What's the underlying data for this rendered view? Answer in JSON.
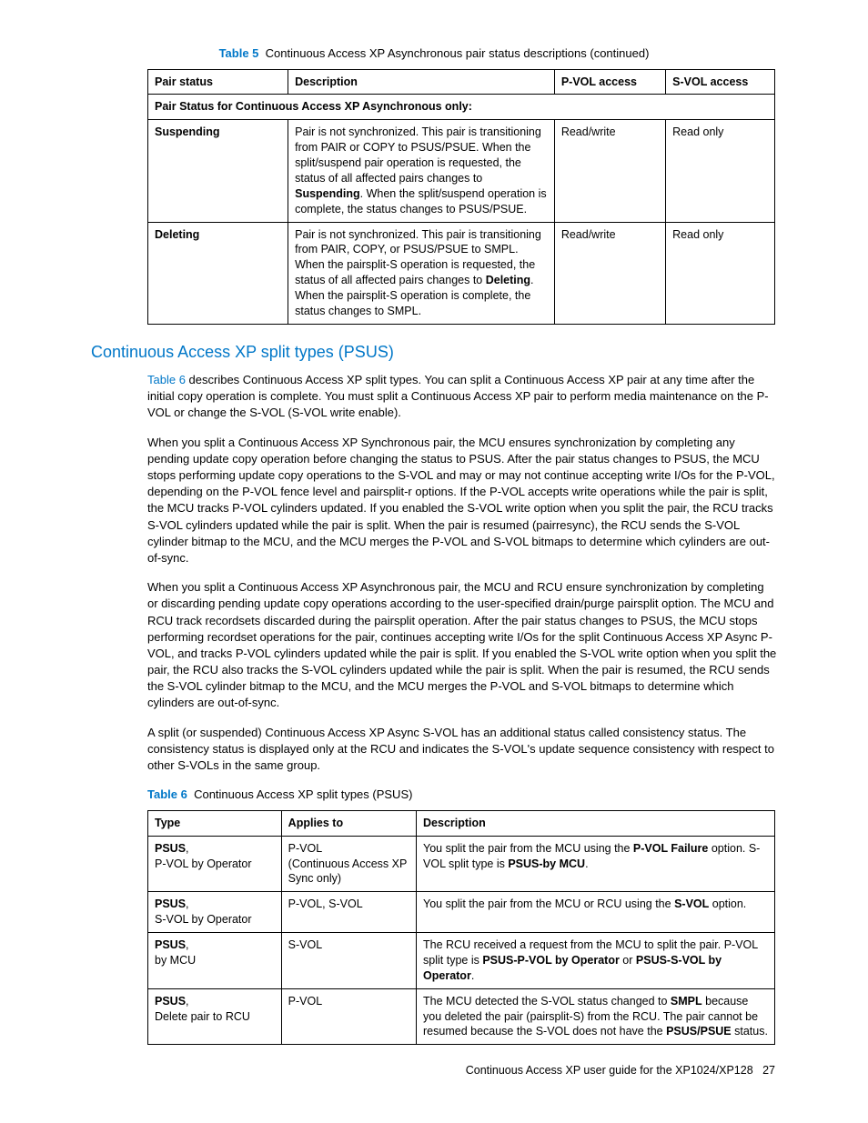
{
  "table5": {
    "caption_label": "Table 5",
    "caption_text": "Continuous Access XP Asynchronous pair status descriptions (continued)",
    "headers": [
      "Pair status",
      "Description",
      "P-VOL access",
      "S-VOL access"
    ],
    "section_row": "Pair Status for Continuous Access XP Asynchronous only:",
    "rows": [
      {
        "status": "Suspending",
        "desc_pre": "Pair is not synchronized. This pair is transitioning from PAIR or COPY to PSUS/PSUE. When the split/suspend pair operation is requested, the status of all affected pairs changes to ",
        "desc_bold": "Suspending",
        "desc_post": ". When the split/suspend operation is complete, the status changes to PSUS/PSUE.",
        "pvol": "Read/write",
        "svol": "Read only"
      },
      {
        "status": "Deleting",
        "desc_pre": "Pair is not synchronized. This pair is transitioning from PAIR, COPY, or PSUS/PSUE to SMPL. When the pairsplit-S operation is requested, the status of all affected pairs changes to ",
        "desc_bold": "Deleting",
        "desc_post": ". When the pairsplit-S operation is complete, the status changes to SMPL.",
        "pvol": "Read/write",
        "svol": "Read only"
      }
    ]
  },
  "section_heading": "Continuous Access XP split types (PSUS)",
  "paragraphs": {
    "p1_link": "Table 6",
    "p1_rest": " describes Continuous Access XP split types. You can split a Continuous Access XP pair at any time after the initial copy operation is complete. You must split a Continuous Access XP pair to perform media maintenance on the P-VOL or change the S-VOL (S-VOL write enable).",
    "p2": "When you split a Continuous Access XP Synchronous pair, the MCU ensures synchronization by completing any pending update copy operation before changing the status to PSUS. After the pair status changes to PSUS, the MCU stops performing update copy operations to the S-VOL and may or may not continue accepting write I/Os for the P-VOL, depending on the P-VOL fence level and pairsplit-r options. If the P-VOL accepts write operations while the pair is split, the MCU tracks P-VOL cylinders updated. If you enabled the S-VOL write option when you split the pair, the RCU tracks S-VOL cylinders updated while the pair is split. When the pair is resumed (pairresync), the RCU sends the S-VOL cylinder bitmap to the MCU, and the MCU merges the P-VOL and S-VOL bitmaps to determine which cylinders are out-of-sync.",
    "p3": "When you split a Continuous Access XP Asynchronous pair, the MCU and RCU ensure synchronization by completing or discarding pending update copy operations according to the user-specified drain/purge pairsplit option. The MCU and RCU track recordsets discarded during the pairsplit operation. After the pair status changes to PSUS, the MCU stops performing recordset operations for the pair, continues accepting write I/Os for the split Continuous Access XP Async P-VOL, and tracks P-VOL cylinders updated while the pair is split. If you enabled the S-VOL write option when you split the pair, the RCU also tracks the S-VOL cylinders updated while the pair is split. When the pair is resumed, the RCU sends the S-VOL cylinder bitmap to the MCU, and the MCU merges the P-VOL and S-VOL bitmaps to determine which cylinders are out-of-sync.",
    "p4": "A split (or suspended) Continuous Access XP Async S-VOL has an additional status called consistency status. The consistency status is displayed only at the RCU and indicates the S-VOL's update sequence consistency with respect to other S-VOLs in the same group."
  },
  "table6": {
    "caption_label": "Table 6",
    "caption_text": "Continuous Access XP split types (PSUS)",
    "headers": [
      "Type",
      "Applies to",
      "Description"
    ],
    "rows": [
      {
        "type_bold": "PSUS",
        "type_rest": ",\nP-VOL by Operator",
        "applies": "P-VOL\n(Continuous Access XP Sync only)",
        "desc_parts": [
          "You split the pair from the MCU using the ",
          "P-VOL Failure",
          " option. S-VOL split type is ",
          "PSUS-by MCU",
          "."
        ]
      },
      {
        "type_bold": "PSUS",
        "type_rest": ",\nS-VOL by Operator",
        "applies": "P-VOL, S-VOL",
        "desc_parts": [
          "You split the pair from the MCU or RCU using the ",
          "S-VOL",
          " option."
        ]
      },
      {
        "type_bold": "PSUS",
        "type_rest": ",\nby MCU",
        "applies": "S-VOL",
        "desc_parts": [
          "The RCU received a request from the MCU to split the pair. P-VOL split type is ",
          "PSUS-P-VOL by Operator",
          " or ",
          "PSUS-S-VOL by Operator",
          "."
        ]
      },
      {
        "type_bold": "PSUS",
        "type_rest": ",\nDelete pair to RCU",
        "applies": "P-VOL",
        "desc_parts": [
          "The MCU detected the S-VOL status changed to ",
          "SMPL",
          " because you deleted the pair (pairsplit-S) from the RCU. The pair cannot be resumed because the S-VOL does not have the ",
          "PSUS/PSUE",
          " status."
        ]
      }
    ]
  },
  "footer": {
    "text": "Continuous Access XP user guide for the XP1024/XP128",
    "page": "27"
  }
}
